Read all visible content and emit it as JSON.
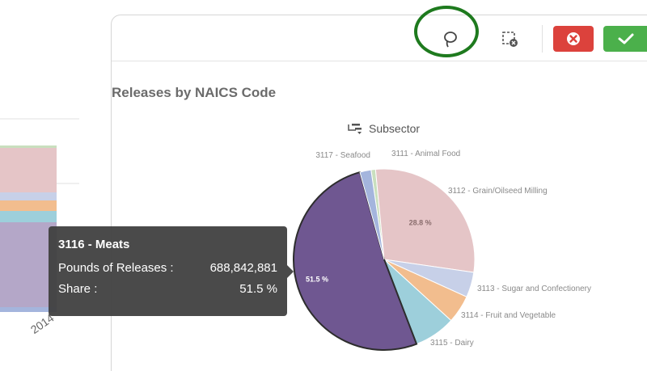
{
  "toolbar": {
    "lasso_icon": "lasso-icon",
    "clear_selection_icon": "clear-selection-icon",
    "cancel_icon": "close-icon",
    "confirm_icon": "check-icon",
    "cancel_color": "#dc423c",
    "confirm_color": "#4bb04b"
  },
  "background_chart": {
    "year_labels": [
      "2014"
    ]
  },
  "chart_data": {
    "type": "pie",
    "title": "Releases by NAICS Code",
    "legend_title": "Subsector",
    "slices": [
      {
        "label": "3111 - Animal Food",
        "share": 0.8,
        "color": "#c9dfbe"
      },
      {
        "label": "3112 - Grain/Oilseed Milling",
        "share": 28.8,
        "color": "#e5c5c7",
        "value_label": "28.8 %"
      },
      {
        "label": "3113 - Sugar and Confectionery",
        "share": 4.5,
        "color": "#c7d0e8"
      },
      {
        "label": "3114 - Fruit and Vegetable",
        "share": 5.0,
        "color": "#f2bd8e"
      },
      {
        "label": "3115 - Dairy",
        "share": 7.4,
        "color": "#9dcfdb"
      },
      {
        "label": "3116 - Meats",
        "share": 51.5,
        "color": "#6f5791",
        "value_label": "51.5 %",
        "selected": true
      },
      {
        "label": "3117 - Seafood",
        "share": 2.0,
        "color": "#a4b5dd"
      }
    ]
  },
  "tooltip": {
    "title": "3116 - Meats",
    "rows": [
      {
        "label": "Pounds of Releases :",
        "value": "688,842,881"
      },
      {
        "label": "Share :",
        "value": "51.5 %"
      }
    ]
  }
}
